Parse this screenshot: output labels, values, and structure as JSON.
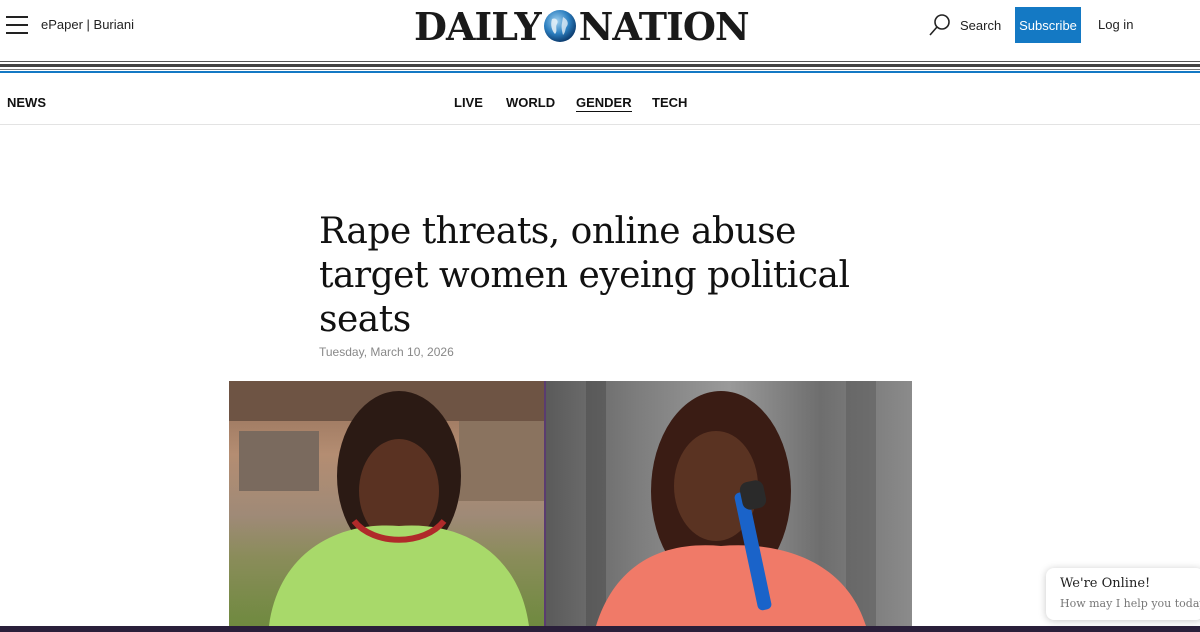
{
  "header": {
    "epaper_label": "ePaper | Buriani",
    "logo": {
      "left_text": "DAILY",
      "right_text": "NATION"
    },
    "search_label": "Search",
    "subscribe_label": "Subscribe",
    "login_label": "Log in"
  },
  "nav": {
    "section_label": "NEWS",
    "items": [
      {
        "label": "LIVE"
      },
      {
        "label": "WORLD"
      },
      {
        "label": "GENDER",
        "active": true
      },
      {
        "label": "TECH"
      }
    ]
  },
  "article": {
    "headline": "Rape threats, online abuse target women eyeing political seats",
    "date": "Tuesday, March 10, 2026"
  },
  "chat_widget": {
    "title": "We're Online!",
    "subtitle": "How may I help you today?"
  },
  "colors": {
    "accent": "#1479c4",
    "text": "#111111",
    "muted": "#888888"
  },
  "icons": [
    "menu-icon",
    "globe-icon",
    "search-icon"
  ]
}
